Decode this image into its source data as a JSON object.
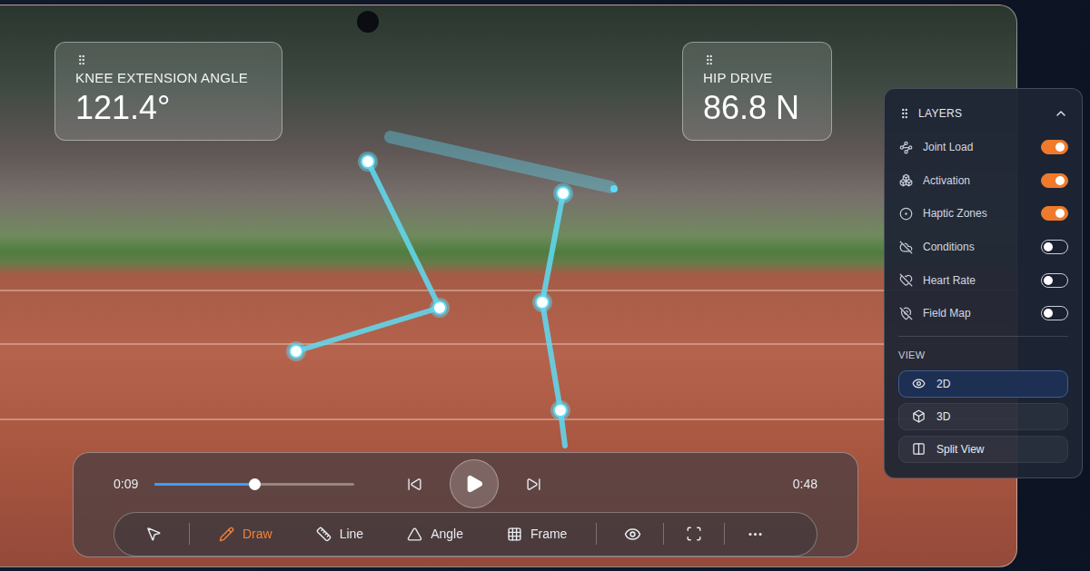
{
  "metrics": [
    {
      "label": "KNEE EXTENSION ANGLE",
      "value": "121.4°"
    },
    {
      "label": "HIP DRIVE",
      "value": "86.8 N"
    }
  ],
  "layers": {
    "title": "LAYERS",
    "expanded": true,
    "items": [
      {
        "name": "Joint Load",
        "on": true
      },
      {
        "name": "Activation",
        "on": true
      },
      {
        "name": "Haptic Zones",
        "on": true
      },
      {
        "name": "Conditions",
        "on": false
      },
      {
        "name": "Heart Rate",
        "on": false
      },
      {
        "name": "Field Map",
        "on": false
      }
    ]
  },
  "view": {
    "title": "VIEW",
    "options": [
      {
        "label": "2D",
        "selected": true
      },
      {
        "label": "3D",
        "selected": false
      },
      {
        "label": "Split View",
        "selected": false
      }
    ]
  },
  "player": {
    "current": "0:09",
    "duration": "0:48",
    "level": 0.5,
    "playing": false
  },
  "tools": [
    {
      "label": "Draw",
      "selected": true
    },
    {
      "label": "Line",
      "selected": false
    },
    {
      "label": "Angle",
      "selected": false
    },
    {
      "label": "Frame",
      "selected": false
    }
  ]
}
